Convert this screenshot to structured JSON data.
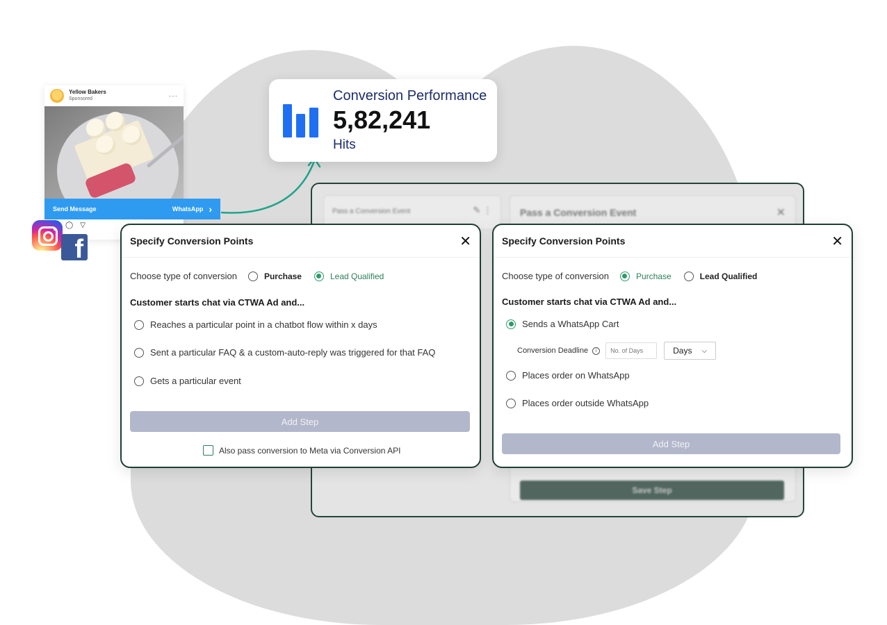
{
  "ad": {
    "brand": "Yellow Bakers",
    "sponsored": "Sponsored",
    "more": "···",
    "cta_left": "Send Message",
    "cta_right": "WhatsApp",
    "chevron": "›"
  },
  "perf": {
    "title": "Conversion Performance",
    "value": "5,82,241",
    "unit": "Hits"
  },
  "bg_panel": {
    "left_card": "Pass a Conversion Event",
    "right_card_title": "Pass a Conversion Event",
    "save_label": "Save Step"
  },
  "modal_left": {
    "title": "Specify Conversion Points",
    "type_label": "Choose type of conversion",
    "opt_purchase": "Purchase",
    "opt_lead": "Lead Qualified",
    "section": "Customer starts chat via CTWA Ad and...",
    "options": [
      "Reaches a particular point in a chatbot flow within x days",
      "Sent a particular FAQ & a custom-auto-reply was triggered for that FAQ",
      "Gets a particular event"
    ],
    "add_step": "Add Step",
    "checkbox": "Also pass conversion to Meta via Conversion API"
  },
  "modal_right": {
    "title": "Specify Conversion Points",
    "type_label": "Choose type of conversion",
    "opt_purchase": "Purchase",
    "opt_lead": "Lead Qualified",
    "section": "Customer starts chat via CTWA Ad and...",
    "option_cart": "Sends a WhatsApp Cart",
    "deadline_label": "Conversion Deadline",
    "deadline_placeholder": "No. of Days",
    "deadline_unit": "Days",
    "option_whatsapp": "Places order on WhatsApp",
    "option_outside": "Places order outside WhatsApp",
    "add_step": "Add Step"
  },
  "colors": {
    "accent_green": "#2e9a6c",
    "dark_green": "#1f3d33",
    "whatsapp_blue": "#2f9bf0",
    "chart_blue": "#1f6ff2",
    "navy": "#1c2d6b"
  }
}
